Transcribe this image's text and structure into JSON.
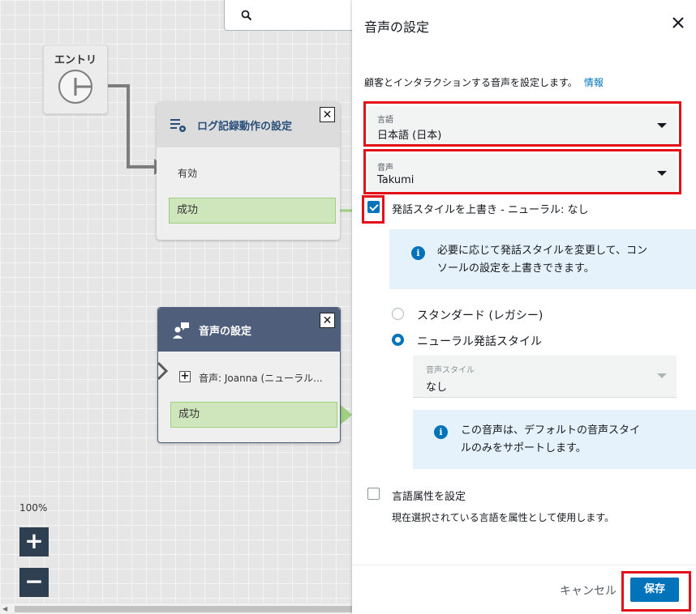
{
  "canvas": {
    "entry_label": "エントリ",
    "zoom_level": "100%",
    "zoom_in": "+",
    "zoom_out": "−",
    "blocks": [
      {
        "title": "ログ記録動作の設定",
        "input_label": "有効",
        "branch_label": "成功",
        "close": "✕"
      },
      {
        "title": "音声の設定",
        "param_label": "音声: Joanna (ニューラル...",
        "branch_label": "成功",
        "close": "✕"
      }
    ]
  },
  "panel": {
    "title": "音声の設定",
    "description": "顧客とインタラクションする音声を設定します。",
    "info_link": "情報",
    "language": {
      "label": "言語",
      "value": "日本語 (日本)"
    },
    "voice": {
      "label": "音声",
      "value": "Takumi"
    },
    "override_checkbox": {
      "label": "発話スタイルを上書き - ニューラル: なし",
      "checked": true
    },
    "info_override": "必要に応じて発話スタイルを変更して、コンソールの設定を上書きできます。",
    "info_override_lines": [
      "必要に応じて発話スタイルを変更して、コン",
      "ソールの設定を上書きできます。"
    ],
    "radio_options": [
      {
        "label": "スタンダード (レガシー)",
        "checked": false
      },
      {
        "label": "ニューラル発話スタイル",
        "checked": true
      }
    ],
    "voice_style": {
      "label": "音声スタイル",
      "value": "なし"
    },
    "info_voice_lines": [
      "この音声は、デフォルトの音声スタイ",
      "ルのみをサポートします。"
    ],
    "language_attr_checkbox": {
      "label": "言語属性を設定",
      "checked": false
    },
    "language_attr_desc": "現在選択されている言語を属性として使用します。",
    "cancel_label": "キャンセル",
    "save_label": "保存"
  },
  "colors": {
    "accent": "#0073bb",
    "highlight": "#e3101a",
    "success_branch": "#cfe6bd",
    "block_header_dark": "#4f5e7b"
  }
}
